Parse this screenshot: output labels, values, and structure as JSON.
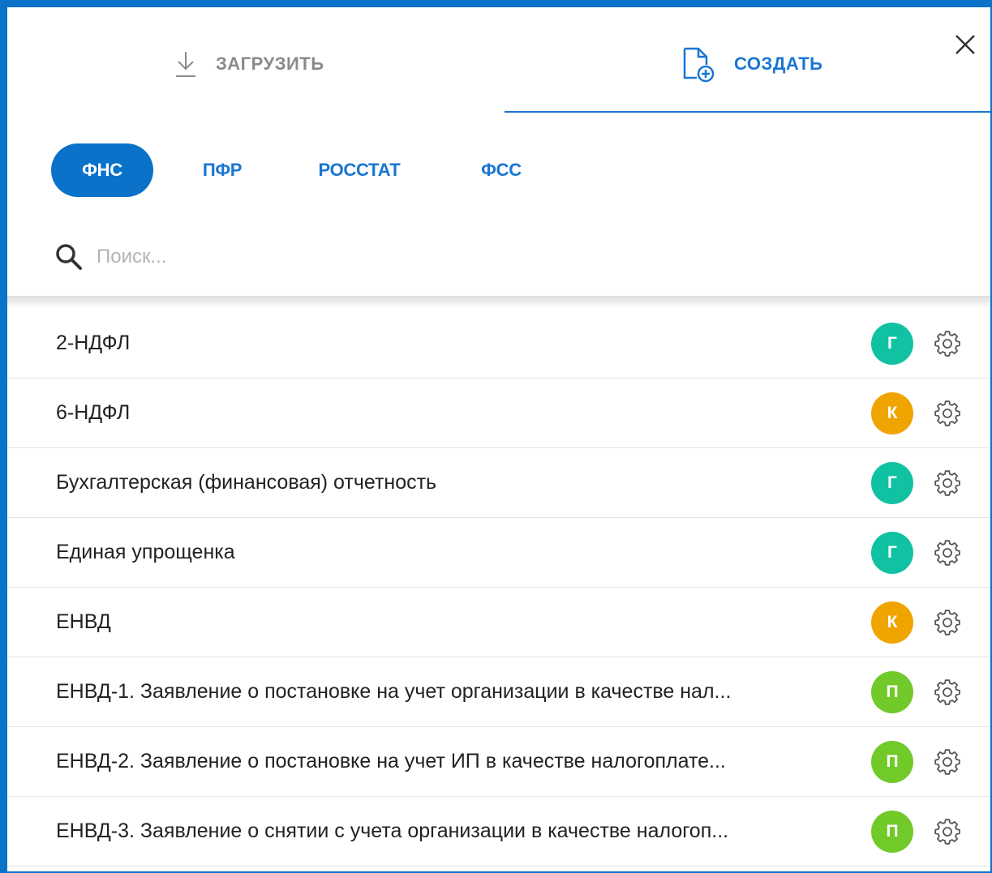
{
  "colors": {
    "accent": "#1976d2",
    "frame": "#0a72c9",
    "badge_green_teal": "#11c2a2",
    "badge_orange": "#f0a400",
    "badge_green": "#72c92a"
  },
  "tabs": [
    {
      "label": "ЗАГРУЗИТЬ",
      "icon": "download-icon",
      "active": false
    },
    {
      "label": "СОЗДАТЬ",
      "icon": "create-document-icon",
      "active": true
    }
  ],
  "categories": [
    {
      "label": "ФНС",
      "active": true
    },
    {
      "label": "ПФР",
      "active": false
    },
    {
      "label": "РОССТАТ",
      "active": false
    },
    {
      "label": "ФСС",
      "active": false
    }
  ],
  "search": {
    "placeholder": "Поиск...",
    "value": ""
  },
  "items": [
    {
      "label": "2-НДФЛ",
      "badge": "Г",
      "badge_color": "#11c2a2"
    },
    {
      "label": "6-НДФЛ",
      "badge": "К",
      "badge_color": "#f0a400"
    },
    {
      "label": "Бухгалтерская (финансовая) отчетность",
      "badge": "Г",
      "badge_color": "#11c2a2"
    },
    {
      "label": "Единая упрощенка",
      "badge": "Г",
      "badge_color": "#11c2a2"
    },
    {
      "label": "ЕНВД",
      "badge": "К",
      "badge_color": "#f0a400"
    },
    {
      "label": "ЕНВД-1. Заявление о постановке на учет организации в качестве нал...",
      "badge": "П",
      "badge_color": "#72c92a"
    },
    {
      "label": "ЕНВД-2. Заявление о постановке на учет ИП в качестве налогоплате...",
      "badge": "П",
      "badge_color": "#72c92a"
    },
    {
      "label": "ЕНВД-3. Заявление о снятии с учета организации в качестве налогоп...",
      "badge": "П",
      "badge_color": "#72c92a"
    }
  ]
}
